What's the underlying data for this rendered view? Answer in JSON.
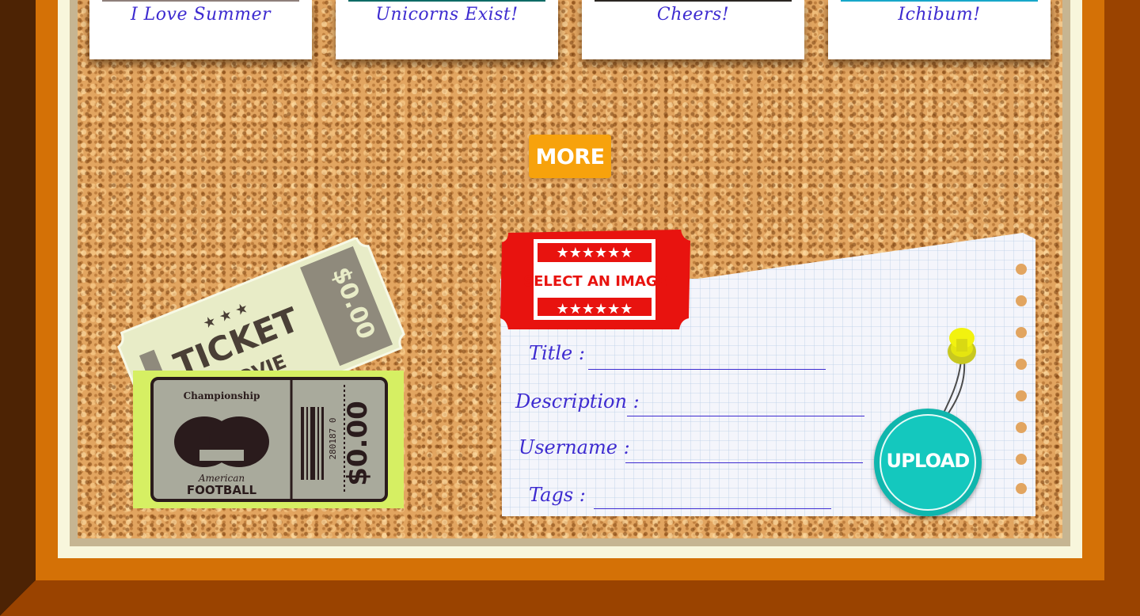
{
  "cards": [
    {
      "caption": "I Love Summer",
      "strip_color": "#8e7f7a"
    },
    {
      "caption": "Unicorns Exist!",
      "strip_color": "#0e6b66"
    },
    {
      "caption": "Cheers!",
      "strip_color": "#2a2622"
    },
    {
      "caption": "Ichibum!",
      "strip_color": "#17a7c9"
    }
  ],
  "more_label": "MORE",
  "select_image_label": "SELECT AN IMAGE",
  "form": {
    "title_label": "Title :",
    "description_label": "Description :",
    "username_label": "Username :",
    "tags_label": "Tags :"
  },
  "upload_label": "UPLOAD",
  "movie_ticket": {
    "word": "TICKET",
    "subword": "MOVIE",
    "price": "$0.00"
  },
  "football_ticket": {
    "top": "Championship",
    "mid": "American",
    "bottom": "FOOTBALL",
    "serial": "280187 0",
    "price": "$0.00"
  },
  "colors": {
    "accent_orange": "#f7a20c",
    "ink_blue": "#3d2bd0",
    "teal": "#14c8be",
    "ticket_red": "#e8130f"
  }
}
